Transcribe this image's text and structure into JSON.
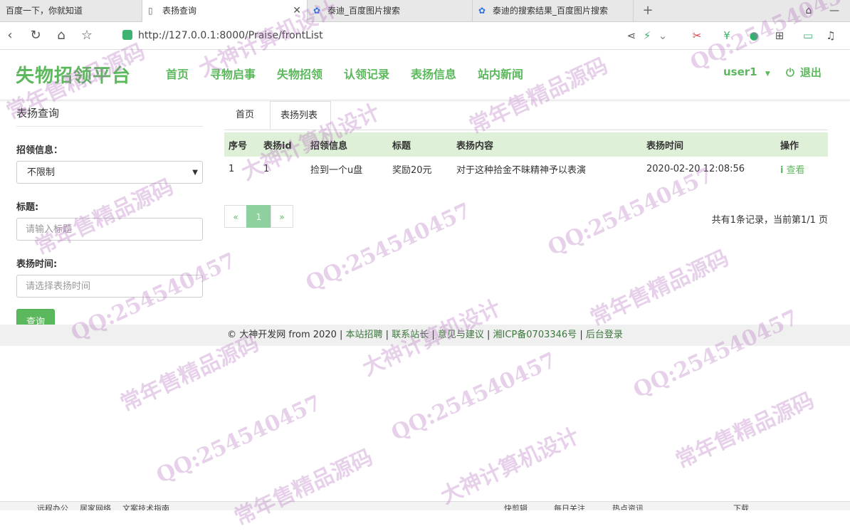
{
  "browser": {
    "tabs": [
      {
        "title": "百度一下，你就知道"
      },
      {
        "title": "表扬查询"
      },
      {
        "title": "泰迪_百度图片搜索"
      },
      {
        "title": "泰迪的搜索结果_百度图片搜索"
      }
    ],
    "url": "http://127.0.0.1:8000/Praise/frontList"
  },
  "site": {
    "brand": "失物招领平台",
    "nav": [
      "首页",
      "寻物启事",
      "失物招领",
      "认领记录",
      "表扬信息",
      "站内新闻"
    ],
    "user": "user1",
    "logout": "退出"
  },
  "sidebar": {
    "title": "表扬查询",
    "field_claim_label": "招领信息：",
    "field_claim_value": "不限制",
    "field_title_label": "标题:",
    "field_title_placeholder": "请输入标题",
    "field_time_label": "表扬时间:",
    "field_time_placeholder": "请选择表扬时间",
    "query_button": "查询"
  },
  "content": {
    "tabs": [
      "首页",
      "表扬列表"
    ],
    "table": {
      "headers": [
        "序号",
        "表扬id",
        "招领信息",
        "标题",
        "表扬内容",
        "表扬时间",
        "操作"
      ],
      "rows": [
        [
          "1",
          "1",
          "捡到一个u盘",
          "奖励20元",
          "对于这种拾金不昧精神予以表演",
          "2020-02-20 12:08:56",
          "查看"
        ]
      ]
    },
    "pager": {
      "prev": "«",
      "current": "1",
      "next": "»",
      "info": "共有1条记录，当前第1/1 页"
    }
  },
  "footer": {
    "copyright": "© 大神开发网 from 2020",
    "links": [
      "本站招聘",
      "联系站长",
      "意见与建议",
      "湘ICP备0703346号",
      "后台登录"
    ]
  },
  "statusbar": {
    "items": [
      "远程办公",
      "居家网络",
      "文案技术指南",
      "快剪辑",
      "每日关注",
      "热点资讯",
      "下载"
    ]
  },
  "watermarks": [
    "大神计算机设计",
    "QQ:254540457",
    "常年售精品源码"
  ]
}
